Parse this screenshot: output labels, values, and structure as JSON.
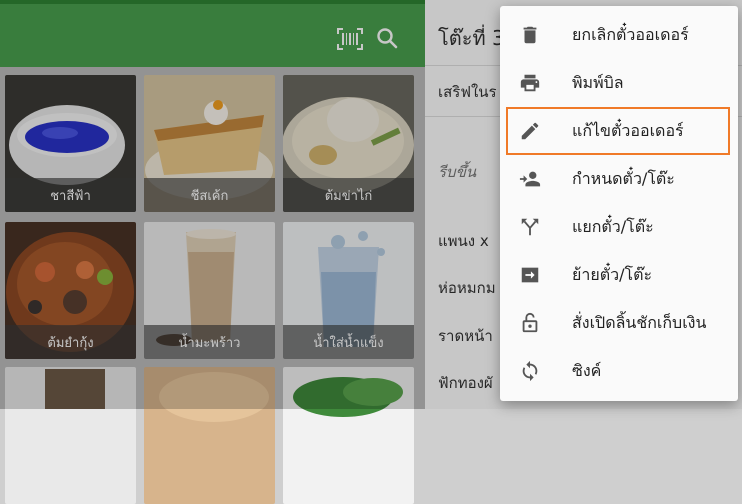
{
  "header": {
    "barcode_icon": "barcode-scan-icon",
    "search_icon": "search-icon",
    "accent": "#4aa04f"
  },
  "products": [
    {
      "name": "ชาสีฟ้า"
    },
    {
      "name": "ชีสเค้ก"
    },
    {
      "name": "ต้มข่าไก่"
    },
    {
      "name": "ต้มยำกุ้ง"
    },
    {
      "name": "น้ำมะพร้าว"
    },
    {
      "name": "น้ำใส่น้ำแข็ง"
    }
  ],
  "order_panel": {
    "title": "โต๊ะที่ 3",
    "serve_label": "เสริฟในร",
    "rush_label": "รีบขึ้น",
    "items": [
      "แพนง x",
      "ห่อหมกม",
      "ราดหน้า",
      "ฟักทองผั"
    ]
  },
  "menu": {
    "items": [
      {
        "label": "ยกเลิกตั๋วออเดอร์",
        "icon": "trash-icon"
      },
      {
        "label": "พิมพ์บิล",
        "icon": "printer-icon"
      },
      {
        "label": "แก้ไขตั๋วออเดอร์",
        "icon": "pencil-icon",
        "active": true
      },
      {
        "label": "กำหนดตั๋ว/โต๊ะ",
        "icon": "assign-person-icon"
      },
      {
        "label": "แยกตั๋ว/โต๊ะ",
        "icon": "split-icon"
      },
      {
        "label": "ย้ายตั๋ว/โต๊ะ",
        "icon": "move-icon"
      },
      {
        "label": "สั่งเปิดลิ้นชักเก็บเงิน",
        "icon": "unlock-icon"
      },
      {
        "label": "ซิงค์",
        "icon": "sync-icon"
      }
    ],
    "highlight_color": "#f07a28"
  }
}
